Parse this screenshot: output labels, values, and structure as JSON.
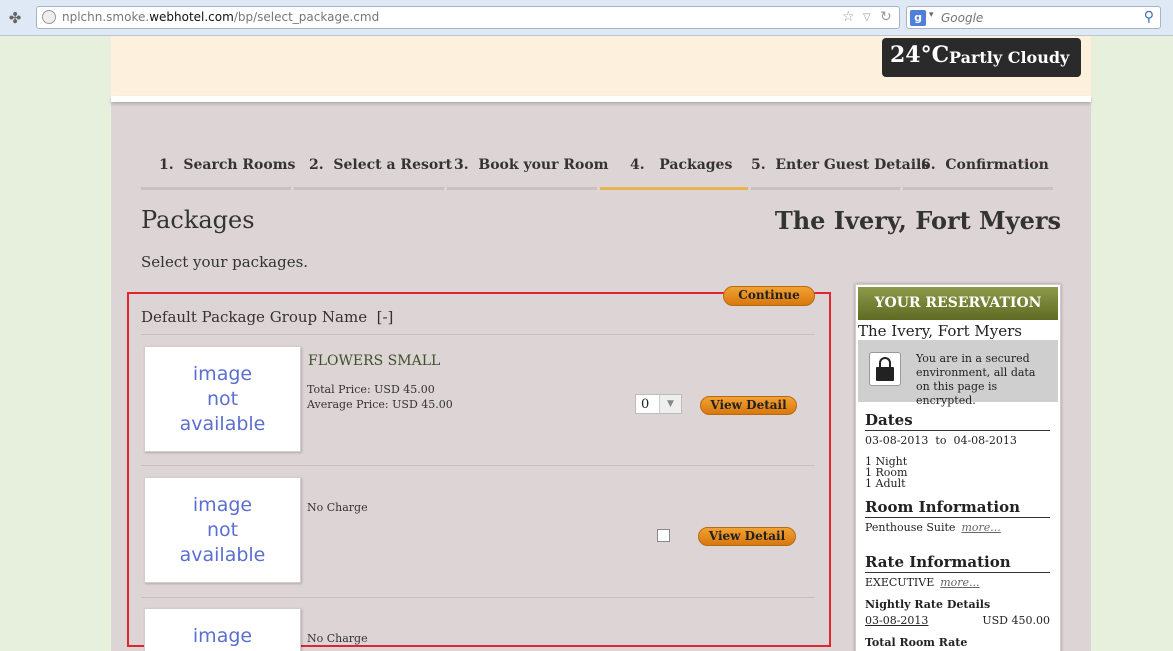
{
  "browser": {
    "url_prefix": "nplchn.smoke.",
    "url_domain": "webhotel.com",
    "url_path": "/bp/select_package.cmd",
    "search_placeholder": "Google"
  },
  "header": {
    "temperature": "24°C",
    "condition": "Partly Cloudy"
  },
  "steps": [
    {
      "num": "1.",
      "label": "Search Rooms"
    },
    {
      "num": "2.",
      "label": "Select a Resort"
    },
    {
      "num": "3.",
      "label": "Book your Room"
    },
    {
      "num": "4.",
      "label": "Packages"
    },
    {
      "num": "5.",
      "label": "Enter Guest Details"
    },
    {
      "num": "6.",
      "label": "Confirmation"
    }
  ],
  "page": {
    "title": "Packages",
    "resort": "The Ivery, Fort Myers",
    "subtitle": "Select your packages.",
    "continue_label": "Continue"
  },
  "group": {
    "title": "Default Package Group Name",
    "toggle": "[-]"
  },
  "no_image": {
    "line1": "image",
    "line2": "not",
    "line3": "available"
  },
  "packages": [
    {
      "name": "FLOWERS SMALL",
      "total_price": "Total Price: USD 45.00",
      "average_price": "Average Price: USD 45.00",
      "quantity": "0",
      "detail_label": "View Detail"
    },
    {
      "charge": "No Charge",
      "detail_label": "View Detail"
    },
    {
      "charge": "No Charge"
    }
  ],
  "reservation": {
    "heading": "YOUR RESERVATION",
    "resort": "The Ivery, Fort Myers",
    "secure_text": "You are in a secured environment, all data on this page is encrypted.",
    "dates_title": "Dates",
    "date_from": "03-08-2013",
    "date_to_word": "to",
    "date_to": "04-08-2013",
    "nights": "1  Night",
    "rooms": "1  Room",
    "adults": "1  Adult",
    "room_info_title": "Room Information",
    "room_type": "Penthouse Suite",
    "more_label": "more...",
    "rate_info_title": "Rate Information",
    "rate_code": "EXECUTIVE",
    "nightly_title": "Nightly Rate Details",
    "nightly_date": "03-08-2013",
    "nightly_price": "USD 450.00",
    "total_title": "Total Room Rate"
  }
}
